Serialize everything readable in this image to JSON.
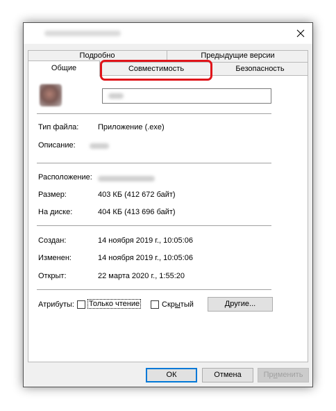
{
  "tabs": {
    "row1": [
      "Подробно",
      "Предыдущие версии"
    ],
    "row2": [
      "Общие",
      "Совместимость",
      "Безопасность"
    ]
  },
  "general": {
    "file_type_label": "Тип файла:",
    "file_type_value": "Приложение (.exe)",
    "description_label": "Описание:",
    "location_label": "Расположение:",
    "size_label": "Размер:",
    "size_value": "403 КБ (412 672 байт)",
    "on_disk_label": "На диске:",
    "on_disk_value": "404 КБ (413 696 байт)",
    "created_label": "Создан:",
    "created_value": "14 ноября 2019 г., 10:05:06",
    "modified_label": "Изменен:",
    "modified_value": "14 ноября 2019 г., 10:05:06",
    "opened_label": "Открыт:",
    "opened_value": "22 марта 2020 г., 1:55:20"
  },
  "attributes": {
    "label": "Атрибуты:",
    "readonly_label": "Только чтение",
    "readonly_checked": false,
    "hidden_label_pre": "Скр",
    "hidden_label_u": "ы",
    "hidden_label_post": "тый",
    "hidden_checked": false,
    "other_pre": "Д",
    "other_rest": "ругие..."
  },
  "buttons": {
    "ok": "ОК",
    "cancel": "Отмена",
    "apply_pre": "Пр",
    "apply_u": "и",
    "apply_post": "менить"
  },
  "colors": {
    "highlight": "#e0141a",
    "default_button_border": "#0078d7"
  }
}
